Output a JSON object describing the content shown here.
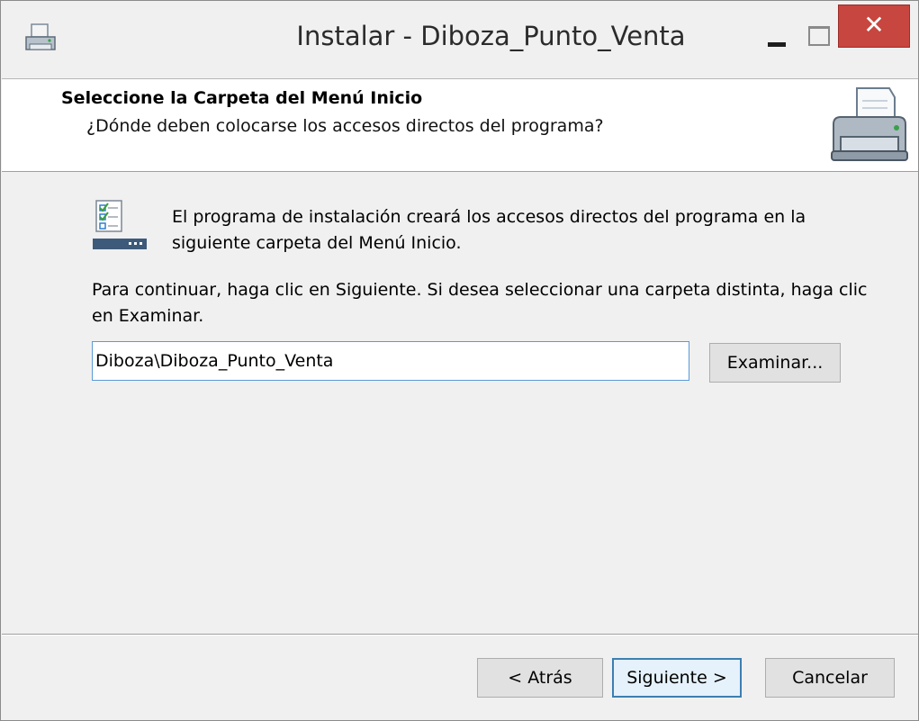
{
  "window": {
    "title": "Instalar - Diboza_Punto_Venta",
    "close_glyph": "✕"
  },
  "header": {
    "title": "Seleccione la Carpeta del Menú Inicio",
    "subtitle": "¿Dónde deben colocarse los accesos directos del programa?"
  },
  "main": {
    "intro_text": "El programa de instalación creará los accesos directos del programa en la siguiente carpeta del Menú Inicio.",
    "instruction_text": "Para continuar, haga clic en Siguiente. Si desea seleccionar una carpeta distinta, haga clic en Examinar.",
    "folder_value": "Diboza\\Diboza_Punto_Venta",
    "browse_label": "Examinar..."
  },
  "footer": {
    "back_label": "< Atrás",
    "next_label": "Siguiente >",
    "cancel_label": "Cancelar"
  },
  "icons": {
    "app": "installer-printer-icon",
    "header": "printer-icon",
    "body": "start-menu-shortcut-icon"
  },
  "colors": {
    "close_button": "#c7463f",
    "default_button_border": "#3c7fb1",
    "input_border": "#5a9bd6"
  }
}
